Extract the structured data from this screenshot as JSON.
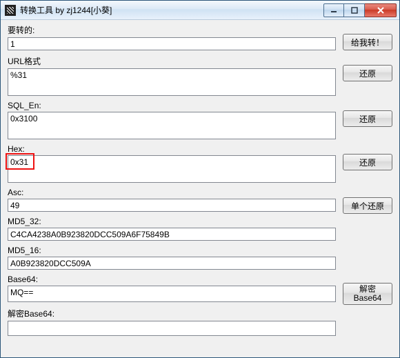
{
  "window": {
    "title": "转换工具 by zj1244[小葵]"
  },
  "buttons": {
    "convert": "给我转！",
    "restore": "还原",
    "single_restore": "单个还原",
    "decrypt_base64": "解密\nBase64"
  },
  "fields": {
    "input": {
      "label": "要转的:",
      "value": "1"
    },
    "url": {
      "label": "URL格式",
      "value": "%31"
    },
    "sql_en": {
      "label": "SQL_En:",
      "value": "0x3100"
    },
    "hex": {
      "label": "Hex:",
      "value": "0x31"
    },
    "asc": {
      "label": "Asc:",
      "value": "49"
    },
    "md5_32": {
      "label": "MD5_32:",
      "value": "C4CA4238A0B923820DCC509A6F75849B"
    },
    "md5_16": {
      "label": "MD5_16:",
      "value": "A0B923820DCC509A"
    },
    "base64": {
      "label": "Base64:",
      "value": "MQ=="
    },
    "decoded": {
      "label": "解密Base64:",
      "value": ""
    }
  },
  "highlight": {
    "field": "hex"
  }
}
